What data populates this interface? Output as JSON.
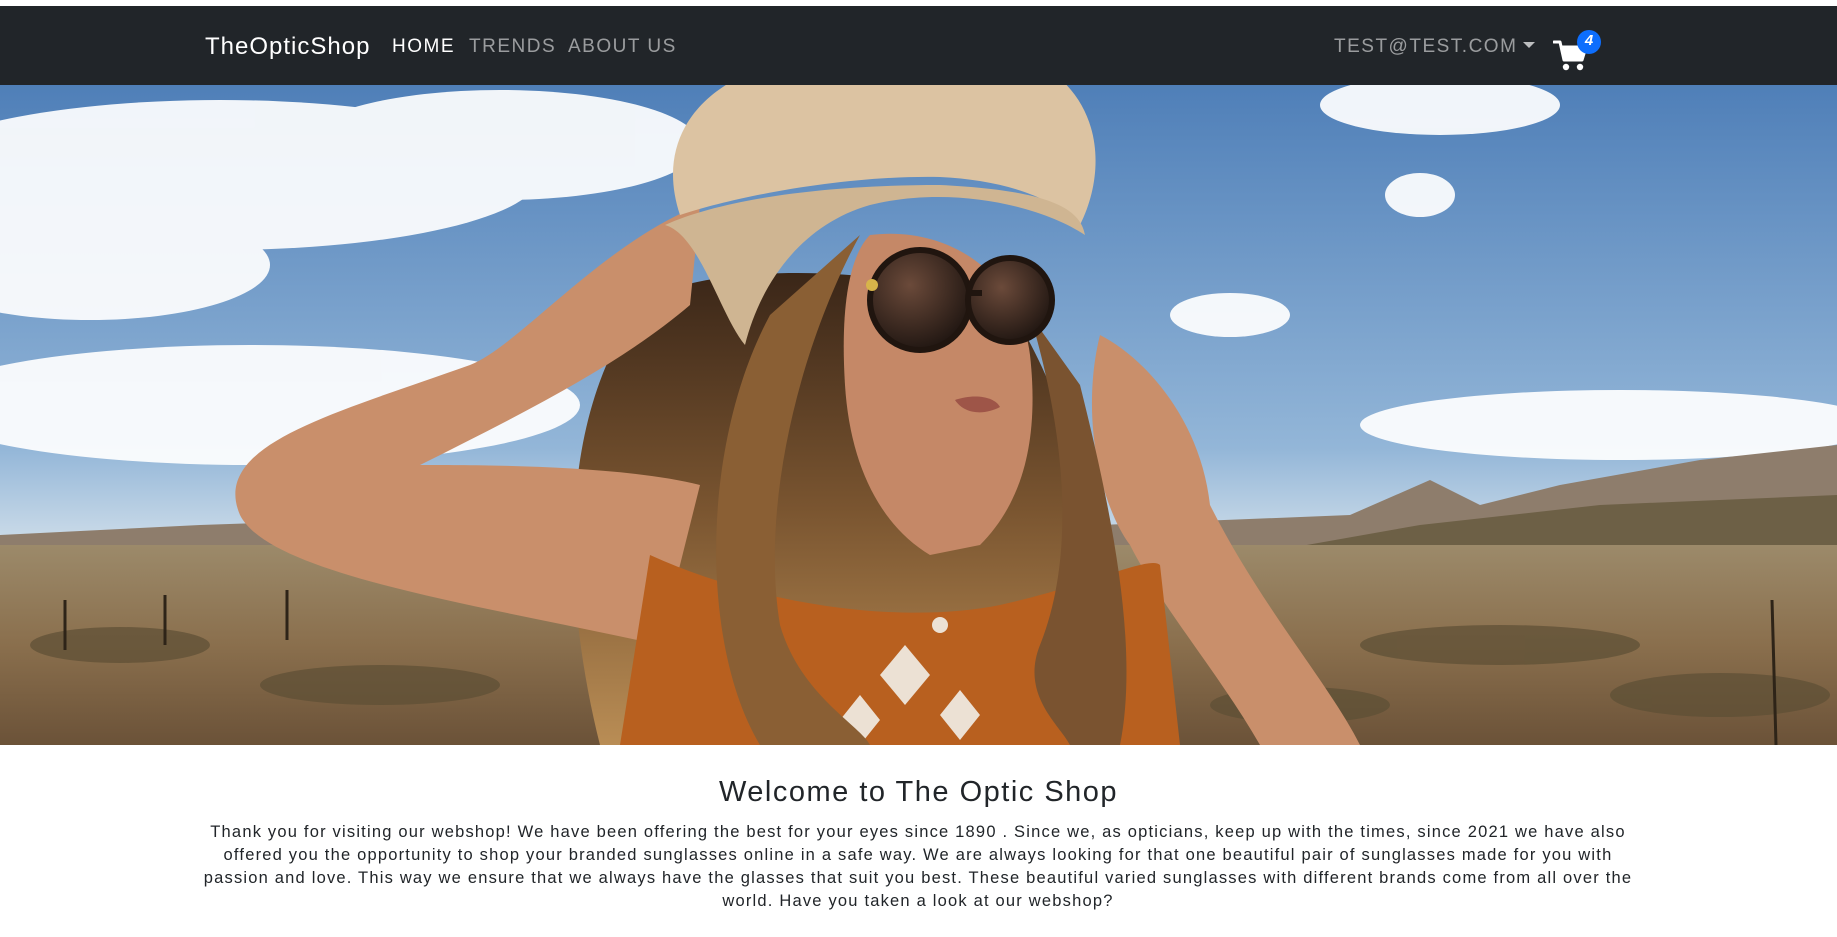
{
  "navbar": {
    "brand": "TheOpticShop",
    "links": [
      {
        "label": "HOME",
        "active": true
      },
      {
        "label": "TRENDS",
        "active": false
      },
      {
        "label": "ABOUT US",
        "active": false
      }
    ],
    "user_email": "TEST@TEST.COM",
    "cart_icon": "cart-icon",
    "cart_count": "4",
    "colors": {
      "background": "#212529",
      "badge": "#0d6efd"
    }
  },
  "hero": {
    "image_description": "woman-in-hat-and-sunglasses-desert"
  },
  "main": {
    "title": "Welcome to The Optic Shop",
    "paragraph": "Thank you for visiting our webshop! We have been offering the best for your eyes since 1890 . Since we, as opticians, keep up with the times, since 2021 we have also offered you the opportunity to shop your branded sunglasses online in a safe way. We are always looking for that one beautiful pair of sunglasses made for you with passion and love. This way we ensure that we always have the glasses that suit you best. These beautiful varied sunglasses with different brands come from all over the world. Have you taken a look at our webshop?"
  }
}
